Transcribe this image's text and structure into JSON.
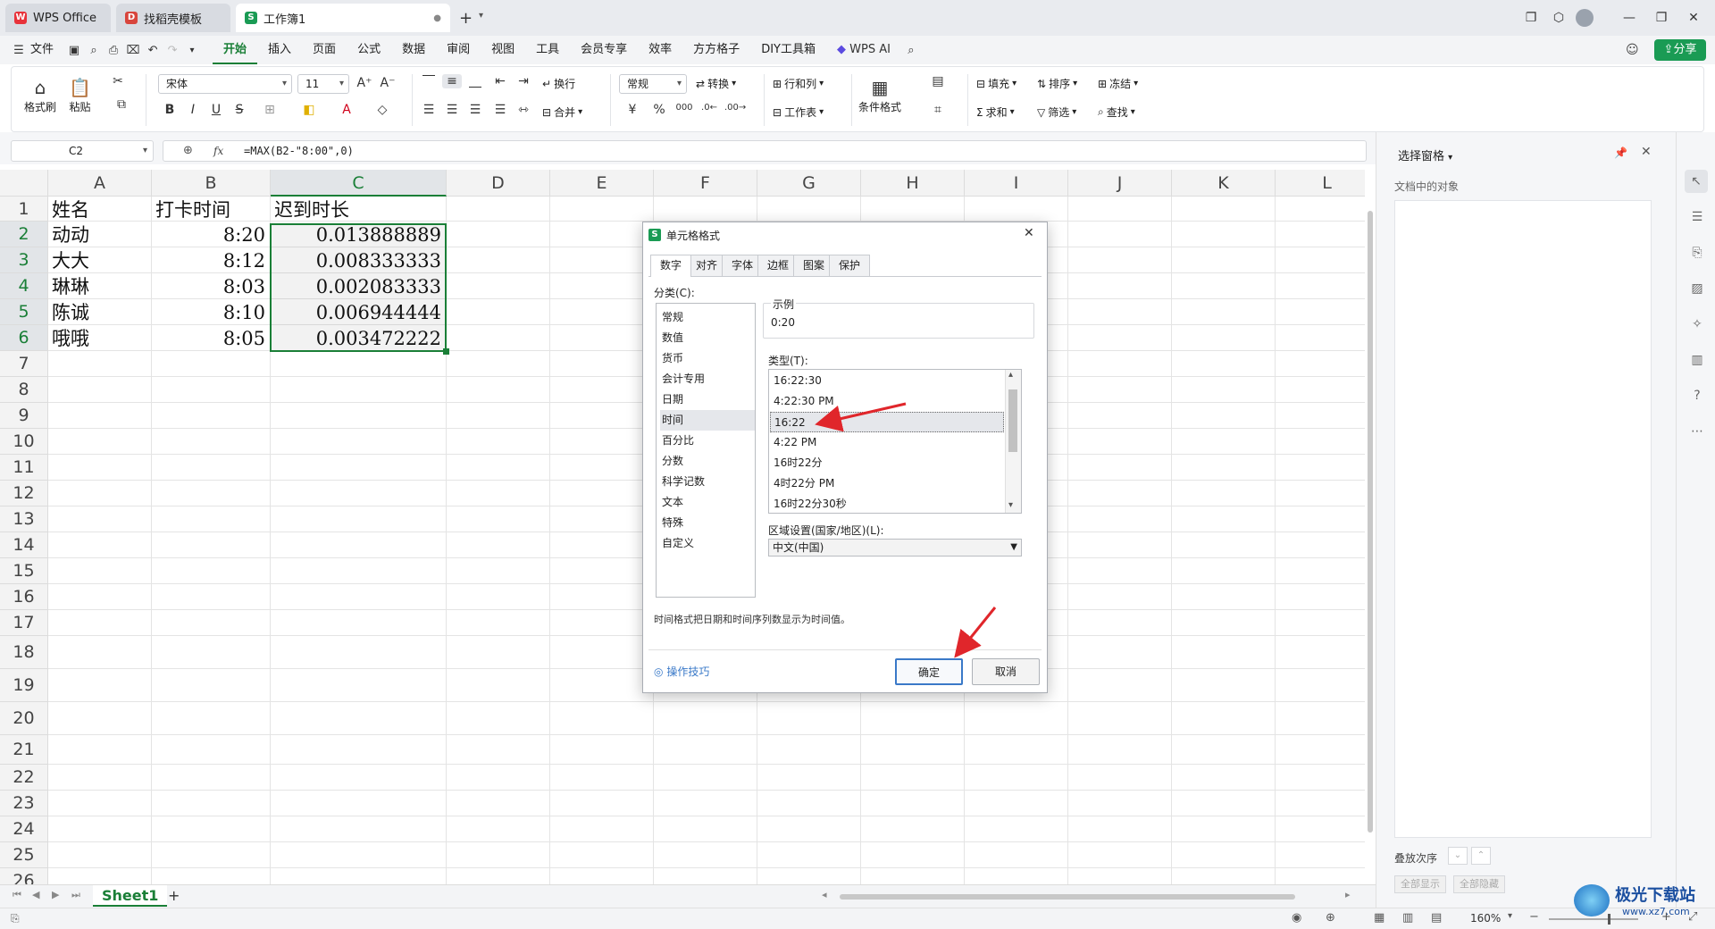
{
  "titlebar": {
    "tabs": [
      {
        "label": "WPS Office",
        "icon": "wps-logo-icon"
      },
      {
        "label": "找稻壳模板",
        "icon": "docer-logo-icon"
      },
      {
        "label": "工作簿1",
        "icon": "sheet-logo-icon"
      }
    ],
    "new_tab": "+"
  },
  "menu": {
    "file": "文件",
    "items": [
      "开始",
      "插入",
      "页面",
      "公式",
      "数据",
      "审阅",
      "视图",
      "工具",
      "会员专享",
      "效率",
      "方方格子",
      "DIY工具箱"
    ],
    "active": "开始",
    "wps_ai": "WPS AI",
    "share": "分享"
  },
  "ribbon": {
    "format_painter": "格式刷",
    "paste": "粘贴",
    "font_name": "宋体",
    "font_size": "11",
    "wrap": "换行",
    "merge": "合并",
    "number_format": "常规",
    "convert": "转换",
    "row_col": "行和列",
    "worksheet": "工作表",
    "cond_format": "条件格式",
    "fill": "填充",
    "sort": "排序",
    "freeze": "冻结",
    "sum": "求和",
    "filter": "筛选",
    "find": "查找",
    "bold": "B",
    "italic": "I",
    "underline": "U",
    "strike": "S",
    "yen": "¥",
    "percent": "%"
  },
  "formula_bar": {
    "cell_ref": "C2",
    "fx": "fx",
    "formula": "=MAX(B2-\"8:00\",0)"
  },
  "sheet": {
    "columns": [
      "A",
      "B",
      "C",
      "D",
      "E",
      "F",
      "G",
      "H",
      "I",
      "J",
      "K",
      "L"
    ],
    "rows": [
      "1",
      "2",
      "3",
      "4",
      "5",
      "6",
      "7",
      "8",
      "9",
      "10",
      "11",
      "12",
      "13",
      "14",
      "15",
      "16",
      "17",
      "18",
      "19",
      "20",
      "21",
      "22",
      "23",
      "24",
      "25",
      "26"
    ],
    "headers": [
      "姓名",
      "打卡时间",
      "迟到时长"
    ],
    "data": [
      [
        "动动",
        "8:20",
        "0.013888889"
      ],
      [
        "大大",
        "8:12",
        "0.008333333"
      ],
      [
        "琳琳",
        "8:03",
        "0.002083333"
      ],
      [
        "陈诚",
        "8:10",
        "0.006944444"
      ],
      [
        "哦哦",
        "8:05",
        "0.003472222"
      ]
    ],
    "tab_name": "Sheet1",
    "add_sheet": "+"
  },
  "status": {
    "zoom": "160%"
  },
  "right_pane": {
    "title": "选择窗格",
    "subtitle": "文档中的对象",
    "order_label": "叠放次序",
    "show_all": "全部显示",
    "hide_all": "全部隐藏"
  },
  "dialog": {
    "title": "单元格格式",
    "tabs": [
      "数字",
      "对齐",
      "字体",
      "边框",
      "图案",
      "保护"
    ],
    "active_tab": "数字",
    "category_label": "分类(C):",
    "categories": [
      "常规",
      "数值",
      "货币",
      "会计专用",
      "日期",
      "时间",
      "百分比",
      "分数",
      "科学记数",
      "文本",
      "特殊",
      "自定义"
    ],
    "selected_category": "时间",
    "sample_label": "示例",
    "sample_value": "0:20",
    "type_label": "类型(T):",
    "types": [
      "16:22:30",
      "4:22:30 PM",
      "16:22",
      "4:22 PM",
      "16时22分",
      "4时22分 PM",
      "16时22分30秒"
    ],
    "selected_type": "16:22",
    "locale_label": "区域设置(国家/地区)(L):",
    "locale_value": "中文(中国)",
    "description": "时间格式把日期和时间序列数显示为时间值。",
    "tips": "操作技巧",
    "ok": "确定",
    "cancel": "取消"
  },
  "watermark": {
    "text": "极光下载站",
    "url": "www.xz7.com"
  },
  "colors": {
    "accent": "#1a7f37",
    "annotation_arrow": "#e0262b",
    "dialog_primary": "#3a79c8"
  }
}
